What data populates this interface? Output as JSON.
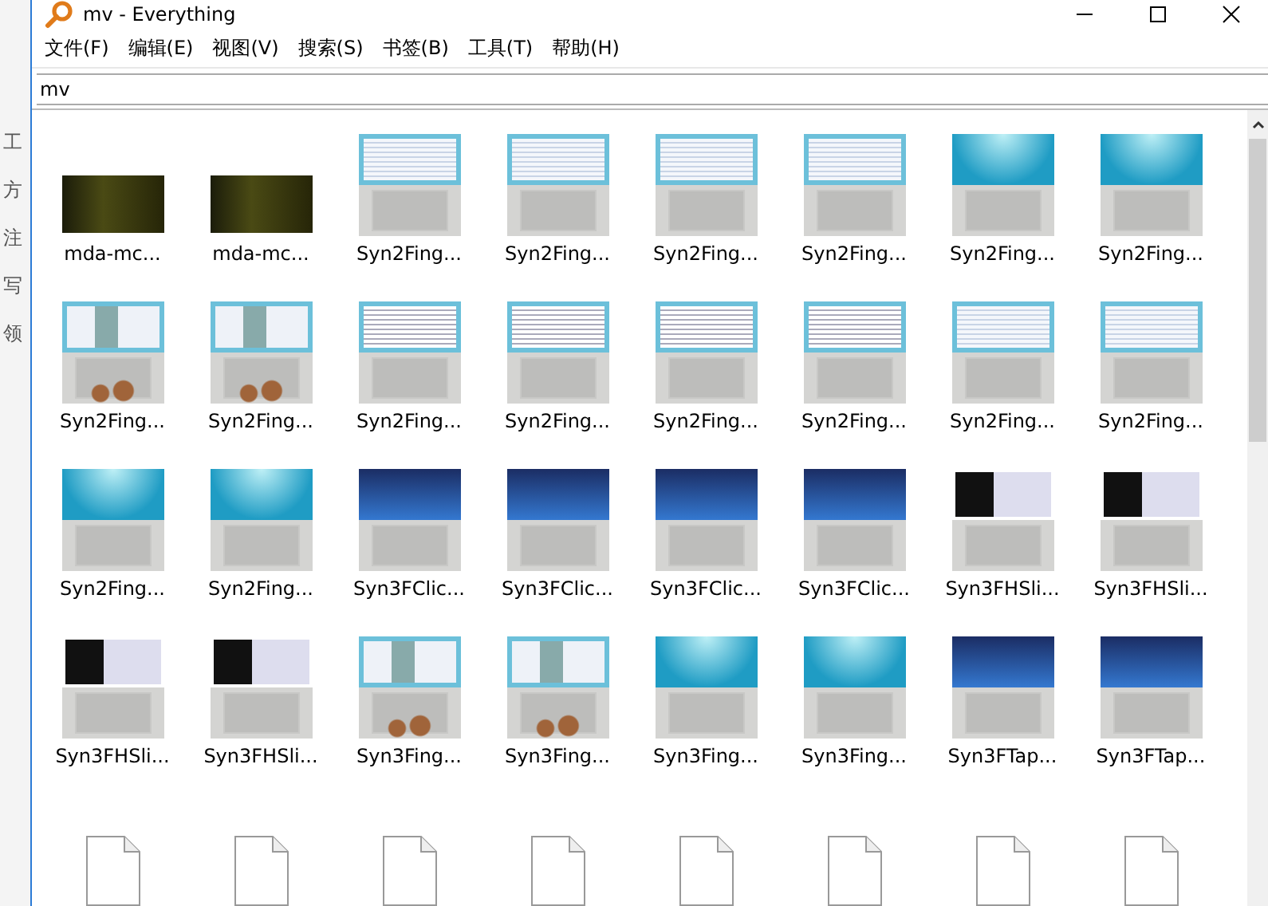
{
  "background_window": {
    "fragments": [
      "工",
      "方",
      "注",
      "写",
      "领"
    ]
  },
  "window": {
    "title": "mv - Everything"
  },
  "menu": [
    "文件(F)",
    "编辑(E)",
    "视图(V)",
    "搜索(S)",
    "书签(B)",
    "工具(T)",
    "帮助(H)"
  ],
  "search": {
    "value": "mv"
  },
  "results": [
    {
      "name": "mda-mc...",
      "kind": "video"
    },
    {
      "name": "mda-mc...",
      "kind": "video"
    },
    {
      "name": "Syn2Fing...",
      "kind": "table"
    },
    {
      "name": "Syn2Fing...",
      "kind": "table"
    },
    {
      "name": "Syn2Fing...",
      "kind": "table"
    },
    {
      "name": "Syn2Fing...",
      "kind": "table"
    },
    {
      "name": "Syn2Fing...",
      "kind": "aqua"
    },
    {
      "name": "Syn2Fing...",
      "kind": "aqua"
    },
    {
      "name": "Syn2Fing...",
      "kind": "hands"
    },
    {
      "name": "Syn2Fing...",
      "kind": "hands"
    },
    {
      "name": "Syn2Fing...",
      "kind": "doc"
    },
    {
      "name": "Syn2Fing...",
      "kind": "doc"
    },
    {
      "name": "Syn2Fing...",
      "kind": "doc"
    },
    {
      "name": "Syn2Fing...",
      "kind": "doc"
    },
    {
      "name": "Syn2Fing...",
      "kind": "table"
    },
    {
      "name": "Syn2Fing...",
      "kind": "table"
    },
    {
      "name": "Syn2Fing...",
      "kind": "aqua"
    },
    {
      "name": "Syn2Fing...",
      "kind": "aqua"
    },
    {
      "name": "Syn3FClic...",
      "kind": "blue"
    },
    {
      "name": "Syn3FClic...",
      "kind": "blue"
    },
    {
      "name": "Syn3FClic...",
      "kind": "blue"
    },
    {
      "name": "Syn3FClic...",
      "kind": "blue"
    },
    {
      "name": "Syn3FHSli...",
      "kind": "dark"
    },
    {
      "name": "Syn3FHSli...",
      "kind": "dark"
    },
    {
      "name": "Syn3FHSli...",
      "kind": "dark"
    },
    {
      "name": "Syn3FHSli...",
      "kind": "dark"
    },
    {
      "name": "Syn3Fing...",
      "kind": "hands"
    },
    {
      "name": "Syn3Fing...",
      "kind": "hands"
    },
    {
      "name": "Syn3Fing...",
      "kind": "aqua"
    },
    {
      "name": "Syn3Fing...",
      "kind": "aqua"
    },
    {
      "name": "Syn3FTap...",
      "kind": "blue"
    },
    {
      "name": "Syn3FTap...",
      "kind": "blue"
    },
    {
      "kind": "file"
    },
    {
      "kind": "file"
    },
    {
      "kind": "file"
    },
    {
      "kind": "file"
    },
    {
      "kind": "file"
    },
    {
      "kind": "file"
    },
    {
      "kind": "file"
    },
    {
      "kind": "file"
    }
  ]
}
